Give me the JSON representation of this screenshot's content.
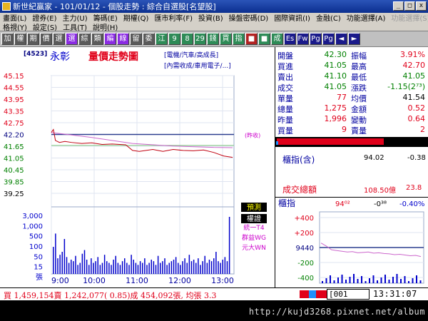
{
  "window": {
    "title": "新世紀贏家 - 101/01/12 - 個股走勢 : 綜合自選股[名望股]",
    "buttons": [
      "_",
      "□",
      "x"
    ]
  },
  "menu": {
    "row1": [
      "畫面(L)",
      "證券(E)",
      "主力(U)",
      "籌碼(E)",
      "期權(Q)",
      "匯市利率(F)",
      "投資(B)",
      "操盤密碼(D)",
      "國際資訊(I)",
      "金融(C)",
      "功能選擇(A)",
      "功能選擇(S)"
    ],
    "row2": [
      "格視(Y)",
      "設定(S)",
      "工具(T)",
      "說明(H)"
    ]
  },
  "toolbar": {
    "buttons": [
      {
        "label": "加",
        "color": "#5a5a5a"
      },
      {
        "label": "權",
        "color": "#5a5a5a"
      },
      {
        "label": "期",
        "color": "#5a5a5a"
      },
      {
        "label": "價",
        "color": "#5a5a5a"
      },
      {
        "label": "選",
        "color": "#5a5a5a"
      },
      {
        "label": "選",
        "color": "#8a2be2"
      },
      {
        "label": "綜",
        "color": "#5a5a5a"
      },
      {
        "label": "類",
        "color": "#5a5a5a"
      },
      {
        "label": "編",
        "color": "#8a2be2"
      },
      {
        "label": "線",
        "color": "#8a2be2"
      },
      {
        "label": "留",
        "color": "#5a5a5a"
      },
      {
        "label": "委",
        "color": "#5a5a5a"
      },
      {
        "label": "江",
        "color": "#2e8b57"
      },
      {
        "label": "9",
        "color": "#2e8b57"
      },
      {
        "label": "8",
        "color": "#2e8b57"
      },
      {
        "label": "29",
        "color": "#2e8b57"
      },
      {
        "label": "錢",
        "color": "#2e8b57"
      },
      {
        "label": "買",
        "color": "#2e8b57"
      },
      {
        "label": "指",
        "color": "#2e8b57"
      },
      {
        "label": "■",
        "color": "#b22222"
      },
      {
        "label": "■",
        "color": "#2e8b57"
      },
      {
        "label": "成",
        "color": "#2e8b57"
      },
      {
        "label": "Es",
        "color": "#1a1a8a"
      },
      {
        "label": "Fw",
        "color": "#1a1a8a"
      },
      {
        "label": "Pg",
        "color": "#1a1a8a"
      },
      {
        "label": "Pg",
        "color": "#1a1a8a"
      },
      {
        "label": "◄",
        "color": "#1a1a8a"
      },
      {
        "label": "►",
        "color": "#1a1a8a"
      }
    ]
  },
  "stock": {
    "code": "[4523]",
    "name": "永彰",
    "chart_title": "量價走勢圖",
    "tags": [
      "[電機/汽車/高成長]",
      "[內需收成/車用電子/...]"
    ],
    "legend_buttons": [
      "預測",
      "權證"
    ],
    "brokers": [
      "統一T4",
      "群益WG",
      "元大WN"
    ],
    "ref_label": "(昨收)"
  },
  "quote": {
    "rows": [
      {
        "l1": "開盤",
        "v1": "42.30",
        "c1": "#008000",
        "l2": "振幅",
        "v2": "3.91%",
        "c2": "#e0001a"
      },
      {
        "l1": "買進",
        "v1": "41.05",
        "c1": "#008000",
        "l2": "最高",
        "v2": "42.70",
        "c2": "#e0001a"
      },
      {
        "l1": "賣出",
        "v1": "41.10",
        "c1": "#008000",
        "l2": "最低",
        "v2": "41.05",
        "c2": "#008000"
      },
      {
        "l1": "成交",
        "v1": "41.05",
        "c1": "#008000",
        "l2": "漲跌",
        "v2": "-1.15(2⁷³)",
        "c2": "#008000"
      },
      {
        "l1": "單量",
        "v1": "77",
        "c1": "#e0001a",
        "l2": "均價",
        "v2": "41.54",
        "c2": "#000000"
      },
      {
        "l1": "總量",
        "v1": "1,275",
        "c1": "#e0001a",
        "l2": "金額",
        "v2": "0.52",
        "c2": "#e0001a"
      },
      {
        "l1": "昨量",
        "v1": "1,996",
        "c1": "#e0001a",
        "l2": "變動",
        "v2": "0.64",
        "c2": "#e0001a"
      },
      {
        "l1": "買量",
        "v1": "9",
        "c1": "#e0001a",
        "l2": "賣量",
        "v2": "2",
        "c2": "#e0001a"
      }
    ],
    "bar_colors": [
      "#e0001a",
      "#1e90ff"
    ]
  },
  "index": {
    "label": "櫃指(含)",
    "value": "94.02",
    "change": "-0.38",
    "volume_label": "成交總額",
    "volume_value": "108.50億",
    "ratio": "23.8"
  },
  "mini_chart": {
    "label": "櫃指",
    "value": "94⁰²",
    "change": "-0³⁸",
    "pct": "-0.40%",
    "y_ticks": [
      "+400",
      "+200",
      "9440",
      "-200",
      "-400"
    ]
  },
  "status": {
    "summary": "買 1,459,154賣 1,242,077( 0.85)成 454,092張, 均張 3.3",
    "code_input": "[001",
    "clock": "13:31:07"
  },
  "footer": {
    "watermark": "http://kujd3268.pixnet.net/album"
  },
  "chart_data": {
    "type": "line",
    "price_ticks": [
      "45.15",
      "44.55",
      "43.95",
      "43.35",
      "42.75",
      "42.20",
      "41.65",
      "41.05",
      "40.45",
      "39.85",
      "39.25"
    ],
    "volume_ticks": [
      "3,000",
      "1,000",
      "500",
      "100",
      "50",
      "15",
      "張"
    ],
    "time_ticks": [
      "9:00",
      "10:00",
      "11:00",
      "12:00",
      "13:00"
    ],
    "y_range": [
      39.25,
      45.15
    ],
    "prev_close": 42.2,
    "avg_price": 41.54,
    "price_series": [
      {
        "t": 0,
        "v": 42.3
      },
      {
        "t": 3,
        "v": 42.45
      },
      {
        "t": 6,
        "v": 41.9
      },
      {
        "t": 12,
        "v": 41.8
      },
      {
        "t": 20,
        "v": 41.85
      },
      {
        "t": 30,
        "v": 41.8
      },
      {
        "t": 45,
        "v": 41.75
      },
      {
        "t": 60,
        "v": 41.78
      },
      {
        "t": 75,
        "v": 41.7
      },
      {
        "t": 90,
        "v": 41.72
      },
      {
        "t": 110,
        "v": 41.68
      },
      {
        "t": 120,
        "v": 41.4
      },
      {
        "t": 130,
        "v": 41.35
      },
      {
        "t": 150,
        "v": 41.45
      },
      {
        "t": 165,
        "v": 41.35
      },
      {
        "t": 180,
        "v": 41.45
      },
      {
        "t": 195,
        "v": 41.4
      },
      {
        "t": 210,
        "v": 41.38
      },
      {
        "t": 225,
        "v": 41.42
      },
      {
        "t": 240,
        "v": 41.3
      },
      {
        "t": 255,
        "v": 41.12
      },
      {
        "t": 268,
        "v": 41.05
      }
    ],
    "avg_series": [
      {
        "t": 0,
        "v": 42.3
      },
      {
        "t": 60,
        "v": 42.05
      },
      {
        "t": 120,
        "v": 41.75
      },
      {
        "t": 180,
        "v": 41.62
      },
      {
        "t": 240,
        "v": 41.55
      },
      {
        "t": 268,
        "v": 41.54
      }
    ],
    "volume_series": [
      18,
      40,
      6,
      9,
      12,
      30,
      7,
      3,
      5,
      4,
      8,
      2,
      3,
      10,
      14,
      5,
      2,
      6,
      3,
      4,
      7,
      2,
      3,
      9,
      4,
      3,
      2,
      5,
      8,
      3,
      2,
      4,
      6,
      3,
      2,
      9,
      5,
      3,
      2,
      4,
      3,
      6,
      2,
      3,
      5,
      4,
      2,
      8,
      3,
      4,
      6,
      2,
      3,
      4,
      5,
      7,
      3,
      2,
      4,
      6,
      3,
      9,
      4,
      5,
      3,
      6,
      2,
      4,
      8,
      3,
      5,
      4,
      6,
      12,
      4,
      3,
      5,
      7,
      4,
      80
    ],
    "mini_series": [
      60,
      20,
      -30,
      -40,
      -50,
      -60,
      -55,
      -70,
      -65,
      -60,
      -75,
      -70,
      -80,
      -85,
      -95,
      -90,
      -100,
      -110,
      -105,
      -120
    ]
  }
}
